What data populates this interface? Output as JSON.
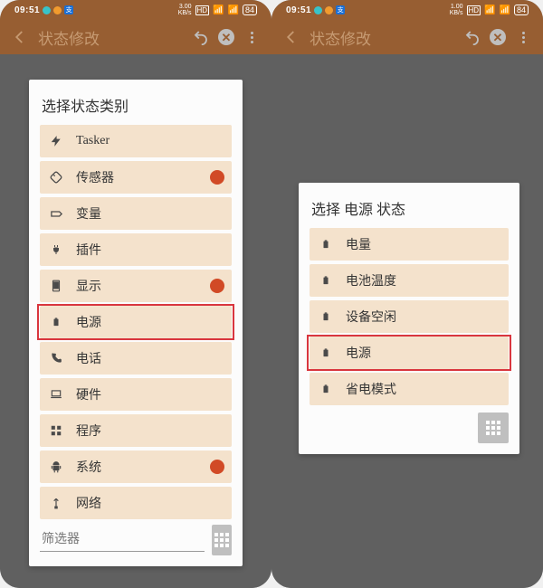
{
  "phoneA": {
    "status": {
      "time": "09:51",
      "speed_val": "3.00",
      "speed_unit": "KB/s",
      "hd": "HD",
      "batt": "84"
    },
    "toolbar": {
      "title": "状态修改"
    },
    "panel": {
      "title": "选择状态类别",
      "items": [
        {
          "icon": "bolt",
          "label": "Tasker",
          "badge": false,
          "hl": false
        },
        {
          "icon": "rotate",
          "label": "传感器",
          "badge": true,
          "hl": false
        },
        {
          "icon": "tag",
          "label": "变量",
          "badge": false,
          "hl": false
        },
        {
          "icon": "plug",
          "label": "插件",
          "badge": false,
          "hl": false
        },
        {
          "icon": "display",
          "label": "显示",
          "badge": true,
          "hl": false
        },
        {
          "icon": "battery",
          "label": "电源",
          "badge": false,
          "hl": true
        },
        {
          "icon": "phone",
          "label": "电话",
          "badge": false,
          "hl": false
        },
        {
          "icon": "laptop",
          "label": "硬件",
          "badge": false,
          "hl": false
        },
        {
          "icon": "modules",
          "label": "程序",
          "badge": false,
          "hl": false
        },
        {
          "icon": "android",
          "label": "系统",
          "badge": true,
          "hl": false
        },
        {
          "icon": "signal",
          "label": "网络",
          "badge": false,
          "hl": false
        }
      ],
      "filter_placeholder": "筛选器"
    }
  },
  "phoneB": {
    "status": {
      "time": "09:51",
      "speed_val": "1.00",
      "speed_unit": "KB/s",
      "hd": "HD",
      "batt": "84"
    },
    "toolbar": {
      "title": "状态修改"
    },
    "panel": {
      "title": "选择 电源 状态",
      "items": [
        {
          "icon": "battery",
          "label": "电量",
          "badge": false,
          "hl": false
        },
        {
          "icon": "battery",
          "label": "电池温度",
          "badge": false,
          "hl": false
        },
        {
          "icon": "battery",
          "label": "设备空闲",
          "badge": false,
          "hl": false
        },
        {
          "icon": "battery",
          "label": "电源",
          "badge": false,
          "hl": true
        },
        {
          "icon": "battery",
          "label": "省电模式",
          "badge": false,
          "hl": false
        }
      ]
    }
  }
}
